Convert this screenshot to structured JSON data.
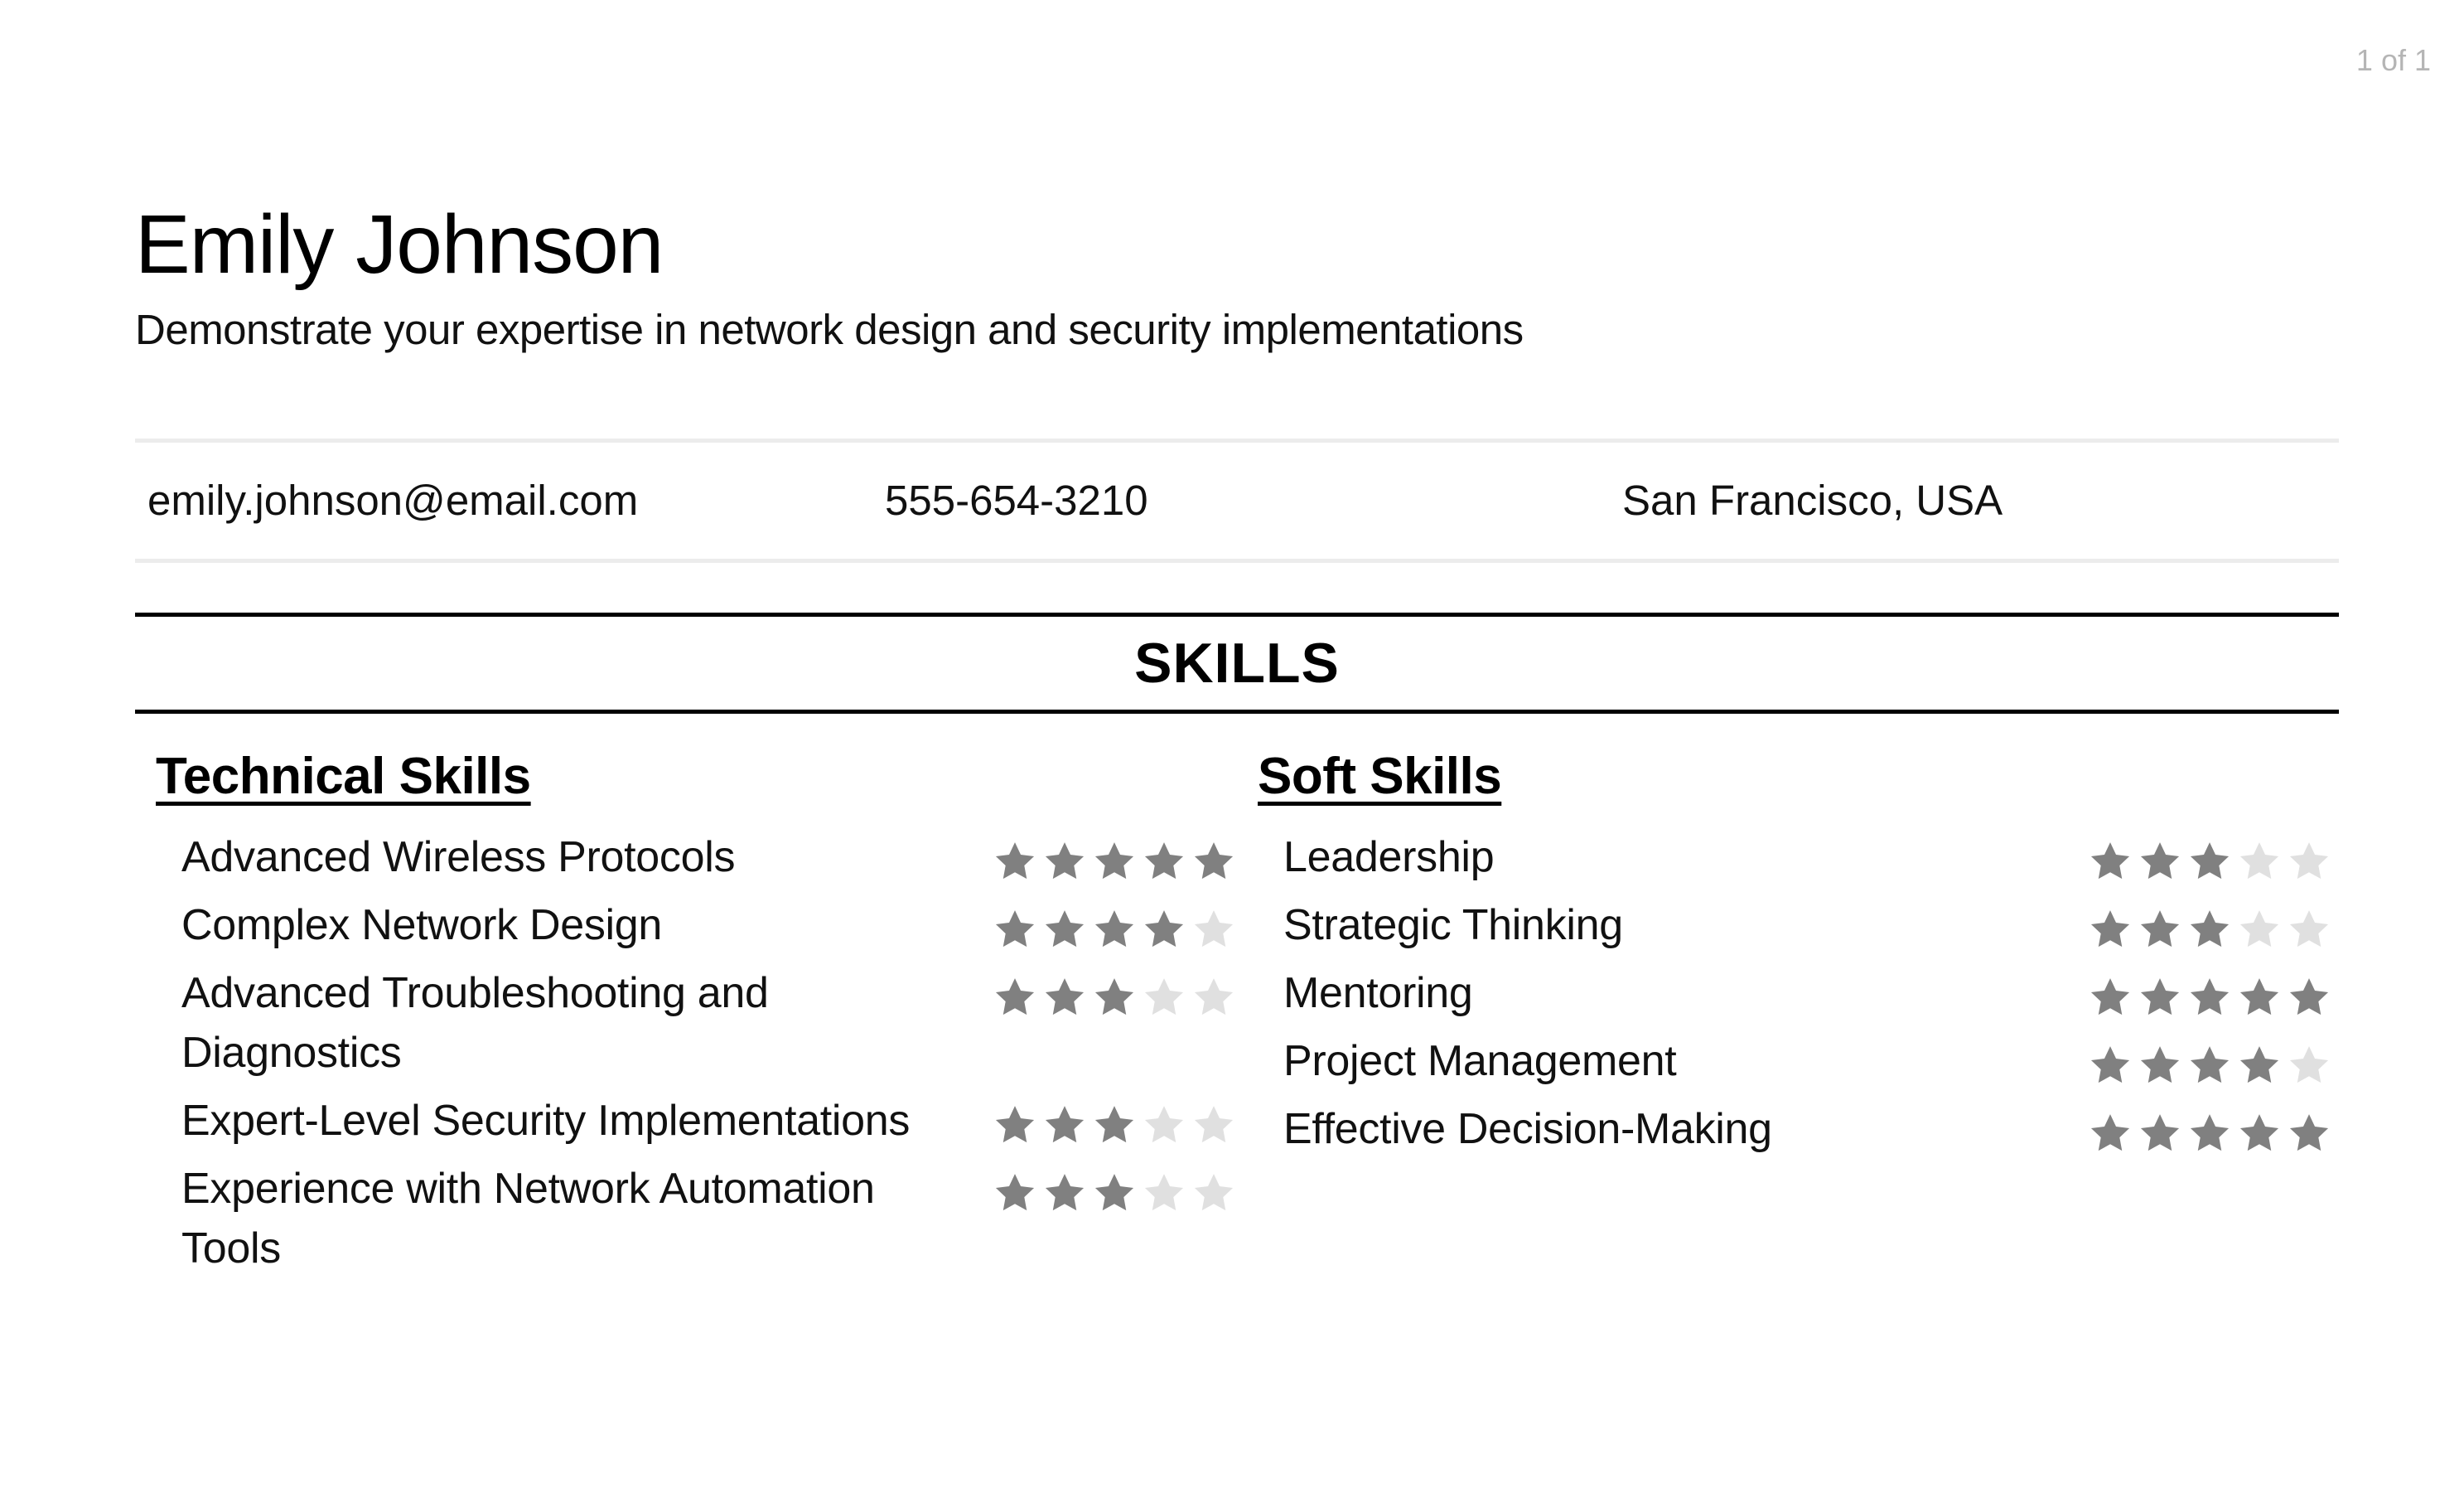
{
  "page_counter": "1 of 1",
  "header": {
    "name": "Emily Johnson",
    "subtitle": "Demonstrate your expertise in network design and security implementations"
  },
  "contact": {
    "email": "emily.johnson@email.com",
    "phone": "555-654-3210",
    "location": "San Francisco, USA"
  },
  "skills_section": {
    "title": "SKILLS",
    "rating_max": 5,
    "colors": {
      "filled": "#808080",
      "empty": "#e0e0e0"
    },
    "technical": {
      "heading": "Technical Skills",
      "items": [
        {
          "name": "Advanced Wireless Protocols",
          "rating": 5
        },
        {
          "name": "Complex Network Design",
          "rating": 4
        },
        {
          "name": "Advanced Troubleshooting and Diagnostics",
          "rating": 3
        },
        {
          "name": "Expert-Level Security Implementations",
          "rating": 3
        },
        {
          "name": "Experience with Network Automation Tools",
          "rating": 3
        }
      ]
    },
    "soft": {
      "heading": "Soft Skills",
      "items": [
        {
          "name": "Leadership",
          "rating": 3
        },
        {
          "name": "Strategic Thinking",
          "rating": 3
        },
        {
          "name": "Mentoring",
          "rating": 5
        },
        {
          "name": "Project Management",
          "rating": 4
        },
        {
          "name": "Effective Decision-Making",
          "rating": 5
        }
      ]
    }
  }
}
